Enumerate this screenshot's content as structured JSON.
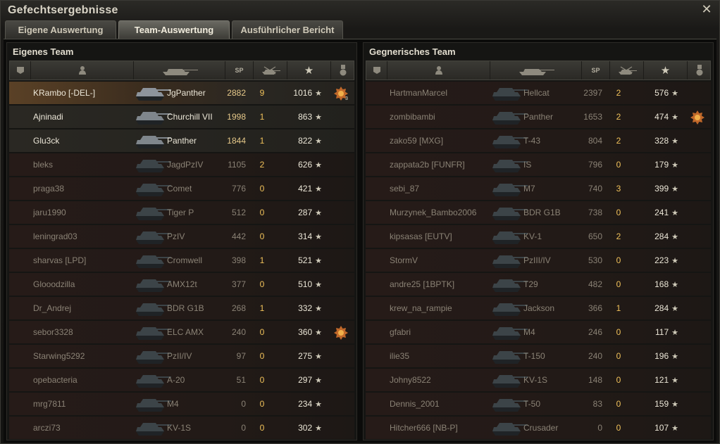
{
  "window": {
    "title": "Gefechtsergebnisse"
  },
  "tabs": [
    {
      "label": "Eigene Auswertung",
      "active": false
    },
    {
      "label": "Team-Auswertung",
      "active": true
    },
    {
      "label": "Ausführlicher Bericht",
      "active": false
    }
  ],
  "headers": {
    "exp": "SP"
  },
  "own_team": {
    "title": "Eigenes Team",
    "players": [
      {
        "name": "KRambo [-DEL-]",
        "tank": "JgPanther",
        "exp": "2882",
        "kills": "9",
        "xp": "1016",
        "status": "me",
        "medal": "3"
      },
      {
        "name": "Ajninadi",
        "tank": "Churchill VII",
        "exp": "1998",
        "kills": "1",
        "xp": "863",
        "status": "alive"
      },
      {
        "name": "Glu3ck",
        "tank": "Panther",
        "exp": "1844",
        "kills": "1",
        "xp": "822",
        "status": "alive"
      },
      {
        "name": "bleks",
        "tank": "JagdPzIV",
        "exp": "1105",
        "kills": "2",
        "xp": "626",
        "status": "dead"
      },
      {
        "name": "praga38",
        "tank": "Comet",
        "exp": "776",
        "kills": "0",
        "xp": "421",
        "status": "dead"
      },
      {
        "name": "jaru1990",
        "tank": "Tiger P",
        "exp": "512",
        "kills": "0",
        "xp": "287",
        "status": "dead"
      },
      {
        "name": "leningrad03",
        "tank": "PzIV",
        "exp": "442",
        "kills": "0",
        "xp": "314",
        "status": "dead"
      },
      {
        "name": "sharvas [LPD]",
        "tank": "Cromwell",
        "exp": "398",
        "kills": "1",
        "xp": "521",
        "status": "dead"
      },
      {
        "name": "Glooodzilla",
        "tank": "AMX12t",
        "exp": "377",
        "kills": "0",
        "xp": "510",
        "status": "dead"
      },
      {
        "name": "Dr_Andrej",
        "tank": "BDR G1B",
        "exp": "268",
        "kills": "1",
        "xp": "332",
        "status": "dead"
      },
      {
        "name": "sebor3328",
        "tank": "ELC AMX",
        "exp": "240",
        "kills": "0",
        "xp": "360",
        "status": "dead",
        "medal": ""
      },
      {
        "name": "Starwing5292",
        "tank": "PzII/IV",
        "exp": "97",
        "kills": "0",
        "xp": "275",
        "status": "dead"
      },
      {
        "name": "opebacteria",
        "tank": "A-20",
        "exp": "51",
        "kills": "0",
        "xp": "297",
        "status": "dead"
      },
      {
        "name": "mrg7811",
        "tank": "M4",
        "exp": "0",
        "kills": "0",
        "xp": "234",
        "status": "dead"
      },
      {
        "name": "arczi73",
        "tank": "KV-1S",
        "exp": "0",
        "kills": "0",
        "xp": "302",
        "status": "dead"
      }
    ]
  },
  "enemy_team": {
    "title": "Gegnerisches Team",
    "players": [
      {
        "name": "HartmanMarcel",
        "tank": "Hellcat",
        "exp": "2397",
        "kills": "2",
        "xp": "576",
        "status": "dead"
      },
      {
        "name": "zombibambi",
        "tank": "Panther",
        "exp": "1653",
        "kills": "2",
        "xp": "474",
        "status": "dead",
        "medal": ""
      },
      {
        "name": "zako59 [MXG]",
        "tank": "T-43",
        "exp": "804",
        "kills": "2",
        "xp": "328",
        "status": "dead"
      },
      {
        "name": "zappata2b [FUNFR]",
        "tank": "IS",
        "exp": "796",
        "kills": "0",
        "xp": "179",
        "status": "dead"
      },
      {
        "name": "sebi_87",
        "tank": "M7",
        "exp": "740",
        "kills": "3",
        "xp": "399",
        "status": "dead"
      },
      {
        "name": "Murzynek_Bambo2006",
        "tank": "BDR G1B",
        "exp": "738",
        "kills": "0",
        "xp": "241",
        "status": "dead"
      },
      {
        "name": "kipsasas [EUTV]",
        "tank": "KV-1",
        "exp": "650",
        "kills": "2",
        "xp": "284",
        "status": "dead"
      },
      {
        "name": "StormV",
        "tank": "PzIII/IV",
        "exp": "530",
        "kills": "0",
        "xp": "223",
        "status": "dead"
      },
      {
        "name": "andre25 [1BPTK]",
        "tank": "T29",
        "exp": "482",
        "kills": "0",
        "xp": "168",
        "status": "dead"
      },
      {
        "name": "krew_na_rampie",
        "tank": "Jackson",
        "exp": "366",
        "kills": "1",
        "xp": "284",
        "status": "dead"
      },
      {
        "name": "gfabri",
        "tank": "M4",
        "exp": "246",
        "kills": "0",
        "xp": "117",
        "status": "dead"
      },
      {
        "name": "ilie35",
        "tank": "T-150",
        "exp": "240",
        "kills": "0",
        "xp": "196",
        "status": "dead"
      },
      {
        "name": "Johny8522",
        "tank": "KV-1S",
        "exp": "148",
        "kills": "0",
        "xp": "121",
        "status": "dead"
      },
      {
        "name": "Dennis_2001",
        "tank": "T-50",
        "exp": "83",
        "kills": "0",
        "xp": "159",
        "status": "dead"
      },
      {
        "name": "Hitcher666 [NB-P]",
        "tank": "Crusader",
        "exp": "0",
        "kills": "0",
        "xp": "107",
        "status": "dead"
      }
    ]
  }
}
